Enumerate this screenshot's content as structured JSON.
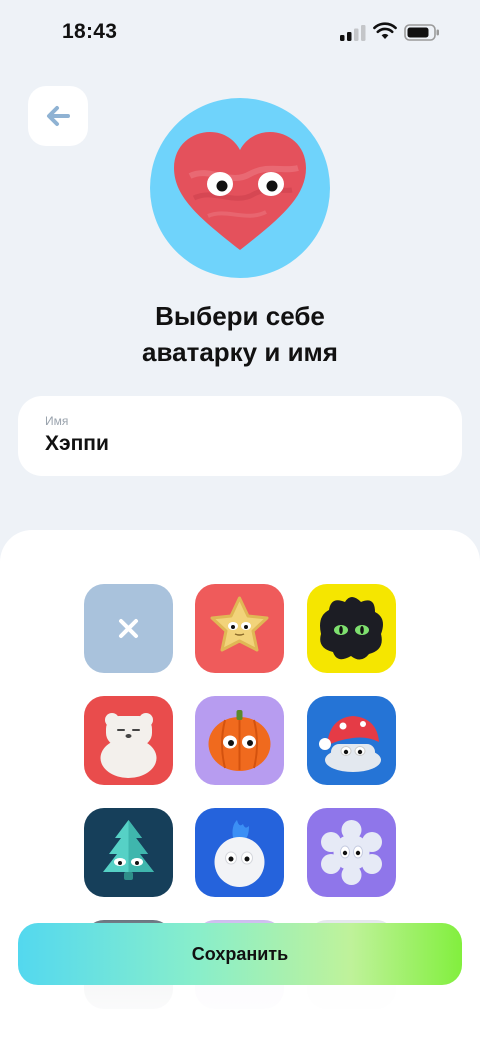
{
  "status_bar": {
    "time": "18:43"
  },
  "header": {
    "title_line1": "Выбери себе",
    "title_line2": "аватарку и имя"
  },
  "name_field": {
    "label": "Имя",
    "value": "Хэппи"
  },
  "avatar": {
    "selected": "heart",
    "background": "#6fd3fb"
  },
  "avatar_grid": [
    {
      "name": "none",
      "background": "#a9c2dc"
    },
    {
      "name": "star",
      "background": "#ef5b5b"
    },
    {
      "name": "black-fluffy",
      "background": "#f5e600"
    },
    {
      "name": "bear",
      "background": "#e94c4c"
    },
    {
      "name": "pumpkin",
      "background": "#b79cf0"
    },
    {
      "name": "mushroom-cap",
      "background": "#2574d6"
    },
    {
      "name": "tree",
      "background": "#163f5a"
    },
    {
      "name": "snowball",
      "background": "#2563dc"
    },
    {
      "name": "snowflake",
      "background": "#8f76ea"
    }
  ],
  "actions": {
    "save_label": "Сохранить"
  }
}
